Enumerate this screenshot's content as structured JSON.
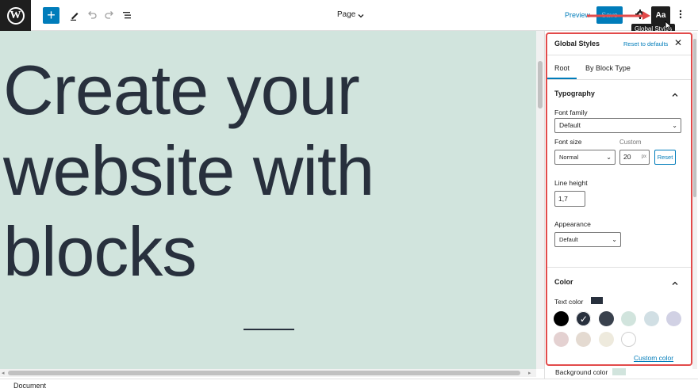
{
  "toolbar": {
    "page_label": "Page",
    "preview_label": "Preview",
    "save_label": "Save",
    "global_styles_button": "Aa",
    "tooltip": "Global Styles"
  },
  "canvas": {
    "heading_lines": [
      "Create your",
      "website with",
      "blocks"
    ],
    "background_color": "#d1e4dd",
    "text_color": "#28303d"
  },
  "footer": {
    "breadcrumb": "Document"
  },
  "sidebar": {
    "title": "Global Styles",
    "reset_label": "Reset to defaults",
    "tabs": [
      {
        "label": "Root",
        "active": true
      },
      {
        "label": "By Block Type",
        "active": false
      }
    ],
    "typography": {
      "title": "Typography",
      "font_family_label": "Font family",
      "font_family_value": "Default",
      "font_size_label": "Font size",
      "custom_label": "Custom",
      "font_size_value": "Normal",
      "custom_value": "20",
      "custom_unit": "px",
      "reset_button": "Reset",
      "line_height_label": "Line height",
      "line_height_value": "1,7",
      "appearance_label": "Appearance",
      "appearance_value": "Default"
    },
    "color": {
      "title": "Color",
      "text_color_label": "Text color",
      "text_color_value": "#28303d",
      "palette": [
        "#000000",
        "#28303d",
        "#39414d",
        "#d1e4dd",
        "#d1dfe4",
        "#d1d1e4",
        "#e4d1d1",
        "#e4dad1",
        "#eeeadd",
        "#ffffff"
      ],
      "selected_index": 1,
      "custom_color_label": "Custom color",
      "background_color_label": "Background color",
      "background_color_value": "#d1e4dd"
    }
  },
  "accent_color": "#007cba",
  "highlight_color": "#e24a4a"
}
